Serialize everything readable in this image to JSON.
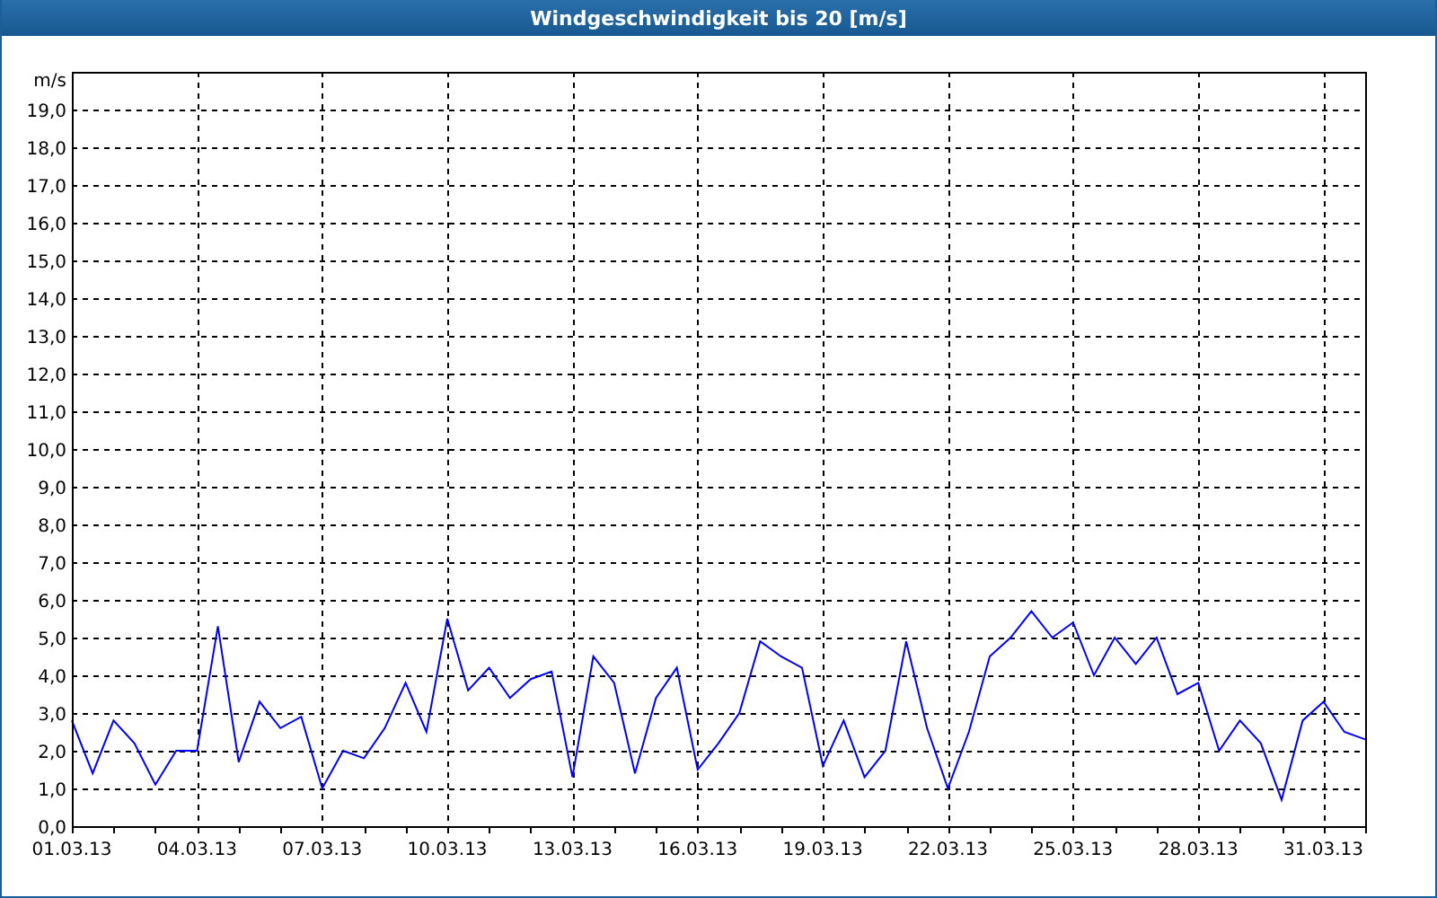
{
  "window": {
    "title": "Windgeschwindigkeit bis 20 [m/s]"
  },
  "chart": {
    "chart_data": {
      "type": "line",
      "ylabel": "m/s",
      "ylim": [
        0,
        20
      ],
      "grid": true,
      "categories": [
        "01.03.13",
        null,
        null,
        null,
        null,
        null,
        "04.03.13",
        null,
        null,
        null,
        null,
        null,
        "07.03.13",
        null,
        null,
        null,
        null,
        null,
        "10.03.13",
        null,
        null,
        null,
        null,
        null,
        "13.03.13",
        null,
        null,
        null,
        null,
        null,
        "16.03.13",
        null,
        null,
        null,
        null,
        null,
        "19.03.13",
        null,
        null,
        null,
        null,
        null,
        "22.03.13",
        null,
        null,
        null,
        null,
        null,
        "25.03.13",
        null,
        null,
        null,
        null,
        null,
        "28.03.13",
        null,
        null,
        null,
        null,
        null,
        "31.03.13",
        null,
        null
      ],
      "yticks": [
        {
          "value": 0,
          "label": "0,0"
        },
        {
          "value": 1,
          "label": "1,0"
        },
        {
          "value": 2,
          "label": "2,0"
        },
        {
          "value": 3,
          "label": "3,0"
        },
        {
          "value": 4,
          "label": "4,0"
        },
        {
          "value": 5,
          "label": "5,0"
        },
        {
          "value": 6,
          "label": "6,0"
        },
        {
          "value": 7,
          "label": "7,0"
        },
        {
          "value": 8,
          "label": "8,0"
        },
        {
          "value": 9,
          "label": "9,0"
        },
        {
          "value": 10,
          "label": "10,0"
        },
        {
          "value": 11,
          "label": "11,0"
        },
        {
          "value": 12,
          "label": "12,0"
        },
        {
          "value": 13,
          "label": "13,0"
        },
        {
          "value": 14,
          "label": "14,0"
        },
        {
          "value": 15,
          "label": "15,0"
        },
        {
          "value": 16,
          "label": "16,0"
        },
        {
          "value": 17,
          "label": "17,0"
        },
        {
          "value": 18,
          "label": "18,0"
        },
        {
          "value": 19,
          "label": "19,0"
        }
      ],
      "series": [
        {
          "color": "#0000ff",
          "values": [
            2.8,
            1.4,
            2.8,
            2.2,
            1.1,
            2.0,
            2.0,
            5.3,
            1.7,
            3.3,
            2.6,
            2.9,
            1.0,
            2.0,
            1.8,
            2.6,
            3.8,
            2.5,
            5.5,
            3.6,
            4.2,
            3.4,
            3.9,
            4.1,
            1.3,
            4.5,
            3.8,
            1.4,
            3.4,
            4.2,
            1.5,
            2.2,
            3.0,
            4.9,
            4.5,
            4.2,
            1.6,
            2.8,
            1.3,
            2.0,
            4.9,
            2.6,
            1.0,
            2.5,
            4.5,
            5.0,
            5.7,
            5.0,
            5.4,
            4.0,
            5.0,
            4.3,
            5.0,
            3.5,
            3.8,
            2.0,
            2.8,
            2.2,
            0.7,
            2.8,
            3.3,
            2.5,
            2.3
          ]
        }
      ]
    }
  }
}
